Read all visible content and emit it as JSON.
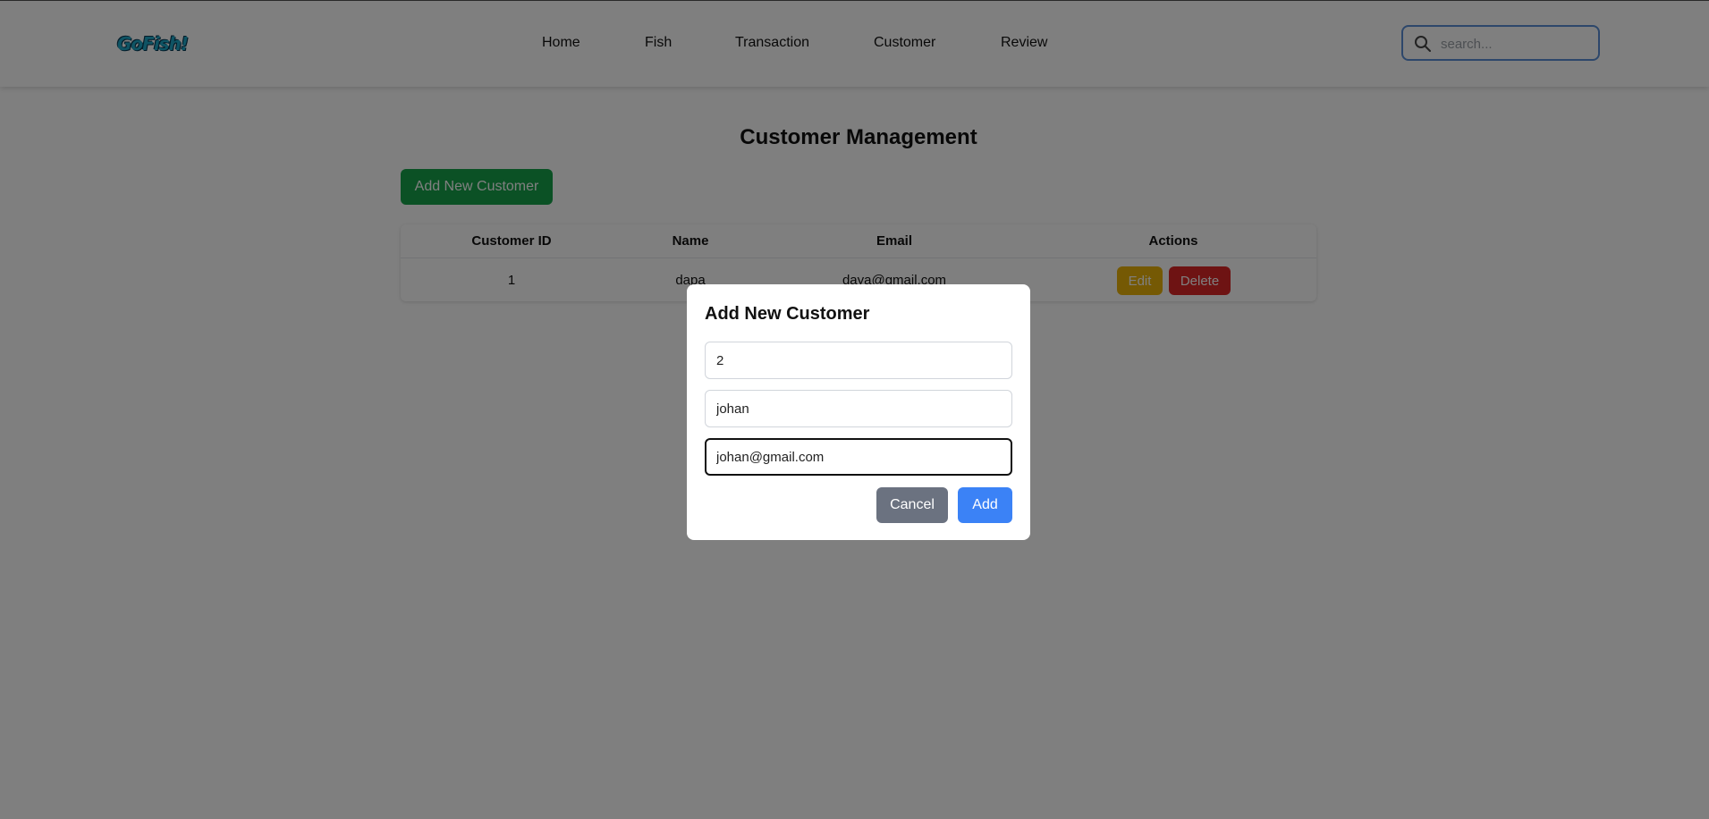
{
  "header": {
    "logo_text": "GoFish!",
    "nav": [
      "Home",
      "Fish",
      "Transaction",
      "Customer",
      "Review"
    ],
    "search": {
      "placeholder": "search...",
      "value": ""
    }
  },
  "main": {
    "title": "Customer Management",
    "add_button_label": "Add New Customer",
    "table": {
      "columns": [
        "Customer ID",
        "Name",
        "Email",
        "Actions"
      ],
      "rows": [
        {
          "id": "1",
          "name": "dapa",
          "email": "daya@gmail.com",
          "edit_label": "Edit",
          "delete_label": "Delete"
        }
      ]
    }
  },
  "modal": {
    "title": "Add New Customer",
    "fields": {
      "id_value": "2",
      "name_value": "johan",
      "email_value": "johan@gmail.com"
    },
    "cancel_label": "Cancel",
    "add_label": "Add"
  },
  "colors": {
    "add_new_button": "#16a34a",
    "edit_button": "#eab308",
    "delete_button": "#dc2626",
    "cancel_button": "#6b7280",
    "add_button": "#3b82f6",
    "search_border": "#5b8fd6"
  }
}
